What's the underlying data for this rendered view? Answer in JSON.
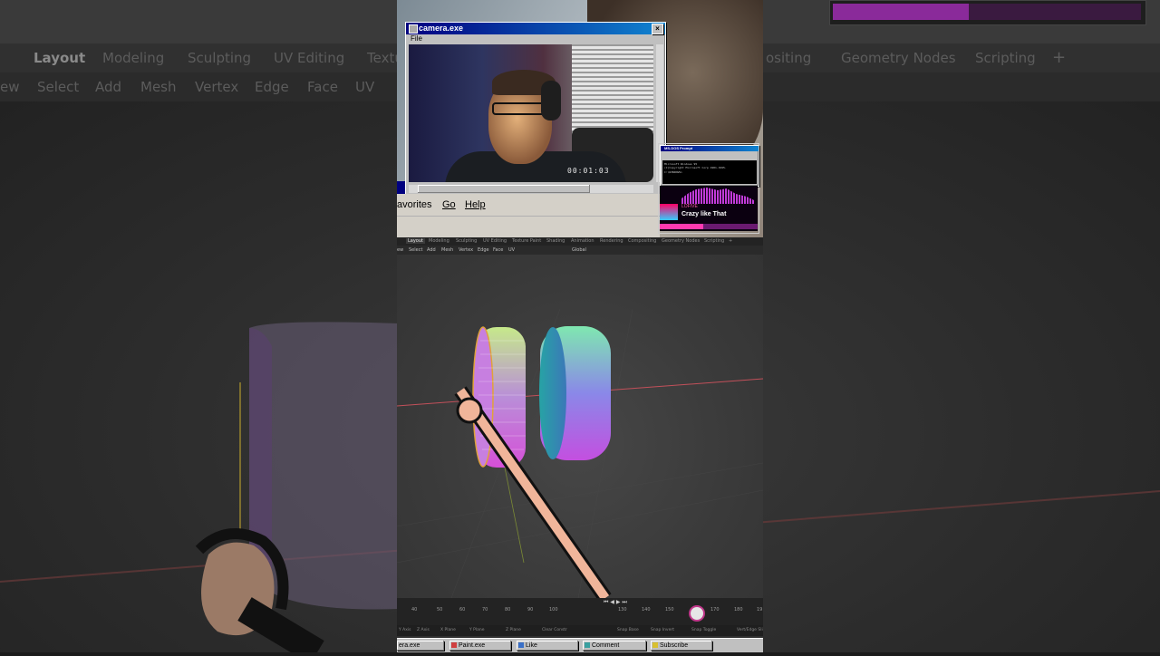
{
  "background": {
    "tabs": [
      "Layout",
      "Modeling",
      "Sculpting",
      "UV Editing",
      "Texture Paint",
      "ositing",
      "Geometry Nodes",
      "Scripting",
      "+"
    ],
    "menu": [
      "ew",
      "Select",
      "Add",
      "Mesh",
      "Vertex",
      "Edge",
      "Face",
      "UV"
    ]
  },
  "camera_window": {
    "title": "camera.exe",
    "menu_file": "File",
    "timestamp": "00:01:03"
  },
  "explorer_menu": {
    "items": [
      "avorites",
      "Go",
      "Help"
    ]
  },
  "dos_window": {
    "title": "MS-DOS Prompt",
    "lines": [
      "Microsoft Windows 95",
      "(C)Copyright Microsoft Corp 1981-1995.",
      "C:\\WINDOWS>"
    ]
  },
  "music_player": {
    "artist": "LOFIVE",
    "track": "Crazy like That"
  },
  "blender": {
    "tabs": [
      "Layout",
      "Modeling",
      "Sculpting",
      "UV Editing",
      "Texture Paint",
      "Shading",
      "Animation",
      "Rendering",
      "Compositing",
      "Geometry Nodes",
      "Scripting",
      "+"
    ],
    "menu": [
      "ew",
      "Select",
      "Add",
      "Mesh",
      "Vertex",
      "Edge",
      "Face",
      "UV",
      "Global"
    ],
    "timeline_numbers": [
      "40",
      "50",
      "60",
      "70",
      "80",
      "90",
      "100",
      "130",
      "140",
      "150",
      "170",
      "180",
      "19"
    ],
    "status_items": [
      "Y Axis",
      "Z Axis",
      "X Plane",
      "Y Plane",
      "Z Plane",
      "Clear Constr",
      "Snap Base",
      "Snap Invert",
      "Snap Toggle",
      "Vert/Edge Sli"
    ]
  },
  "taskbar": {
    "items": [
      "era.exe",
      "Paint.exe",
      "Like",
      "Comment",
      "Subscribe"
    ]
  },
  "colors": {
    "win_title": "#000080",
    "accent_magenta": "#c13bd8",
    "blender_bg": "#303030"
  }
}
